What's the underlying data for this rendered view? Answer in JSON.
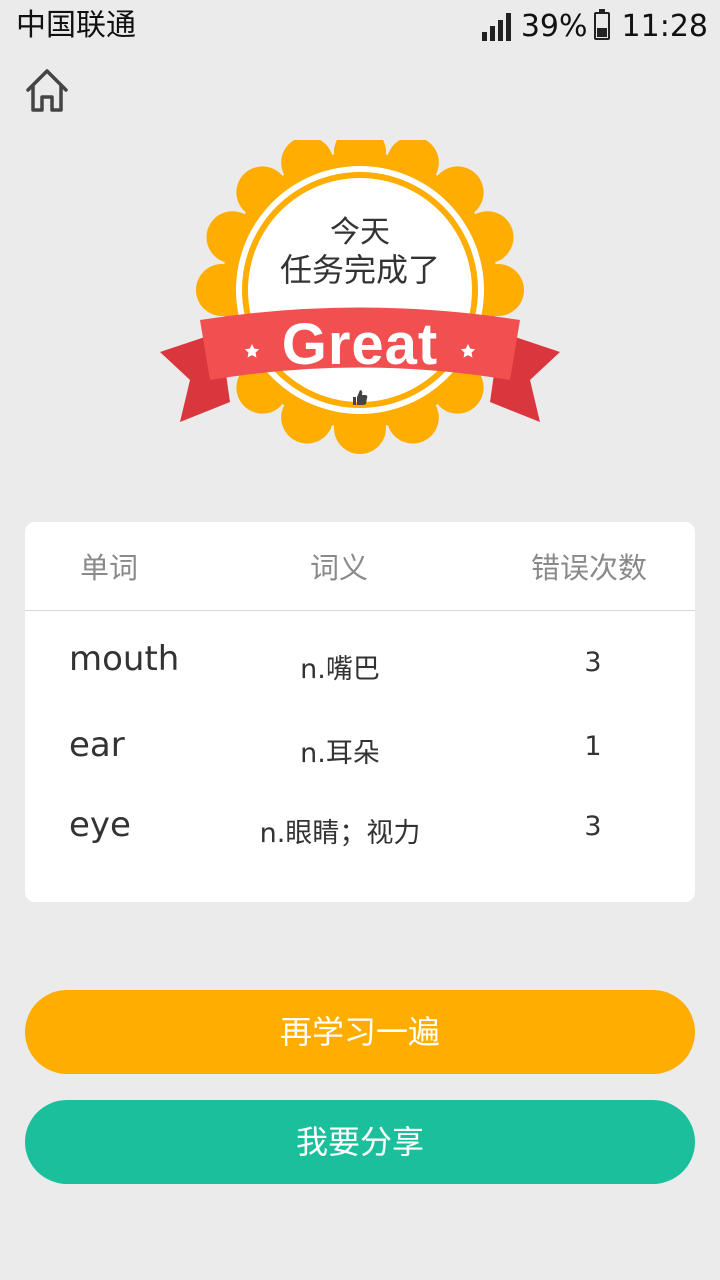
{
  "status_bar": {
    "carrier": "中国联通",
    "battery": "39%",
    "time": "11:28"
  },
  "icons": {
    "home": "home-icon",
    "signal": "signal-icon",
    "battery": "battery-icon",
    "thumb": "thumbs-up-icon",
    "star": "star-icon"
  },
  "badge": {
    "line1": "今天",
    "line2": "任务完成了",
    "great": "Great"
  },
  "colors": {
    "badge_orange": "#ffad00",
    "ribbon_red": "#f25050",
    "ribbon_dark": "#d9363d",
    "share_green": "#1bbf9b",
    "retry_orange": "#ffad00"
  },
  "table": {
    "headers": {
      "word": "单词",
      "meaning": "词义",
      "errors": "错误次数"
    },
    "rows": [
      {
        "word": "mouth",
        "meaning": "n.嘴巴",
        "errors": "3"
      },
      {
        "word": "ear",
        "meaning": "n.耳朵",
        "errors": "1"
      },
      {
        "word": "eye",
        "meaning": "n.眼睛；视力",
        "errors": "3"
      }
    ]
  },
  "buttons": {
    "retry": "再学习一遍",
    "share": "我要分享"
  }
}
